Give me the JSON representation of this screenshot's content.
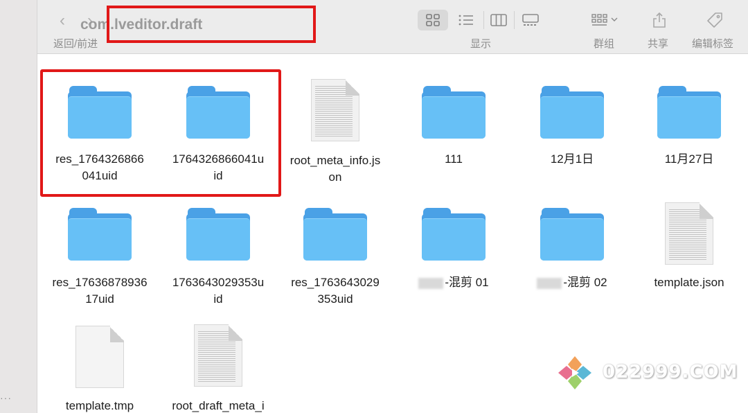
{
  "window": {
    "title": "com.lveditor.draft"
  },
  "toolbar": {
    "back_forward_label": "返回/前进",
    "view_label": "显示",
    "group_label": "群组",
    "share_label": "共享",
    "tags_label": "编辑标签"
  },
  "icons": {
    "back": "chevron-left-icon",
    "forward": "chevron-right-icon",
    "icon_view": "grid-icon",
    "list_view": "list-icon",
    "column_view": "columns-icon",
    "gallery_view": "gallery-icon",
    "group": "group-icon",
    "share": "share-icon",
    "tag": "tag-icon"
  },
  "files": [
    {
      "name": "res_1764326866\n041uid",
      "kind": "folder"
    },
    {
      "name": "1764326866041u\nid",
      "kind": "folder"
    },
    {
      "name": "root_meta_info.js\non",
      "kind": "doc"
    },
    {
      "name": "111",
      "kind": "folder"
    },
    {
      "name": "12月1日",
      "kind": "folder"
    },
    {
      "name": "11月27日",
      "kind": "folder"
    },
    {
      "name": "res_17636878936\n17uid",
      "kind": "folder"
    },
    {
      "name": "1763643029353u\nid",
      "kind": "folder"
    },
    {
      "name": "res_1763643029\n353uid",
      "kind": "folder"
    },
    {
      "name": "-混剪 01",
      "kind": "folder"
    },
    {
      "name": "-混剪 02",
      "kind": "folder"
    },
    {
      "name": "template.json",
      "kind": "doc"
    },
    {
      "name": "template.tmp",
      "kind": "blank"
    },
    {
      "name": "root_draft_meta_i",
      "kind": "doc"
    }
  ],
  "watermark": {
    "text": "022999.COM"
  },
  "colors": {
    "highlight": "#e11818",
    "folder": "#67c0f6"
  }
}
